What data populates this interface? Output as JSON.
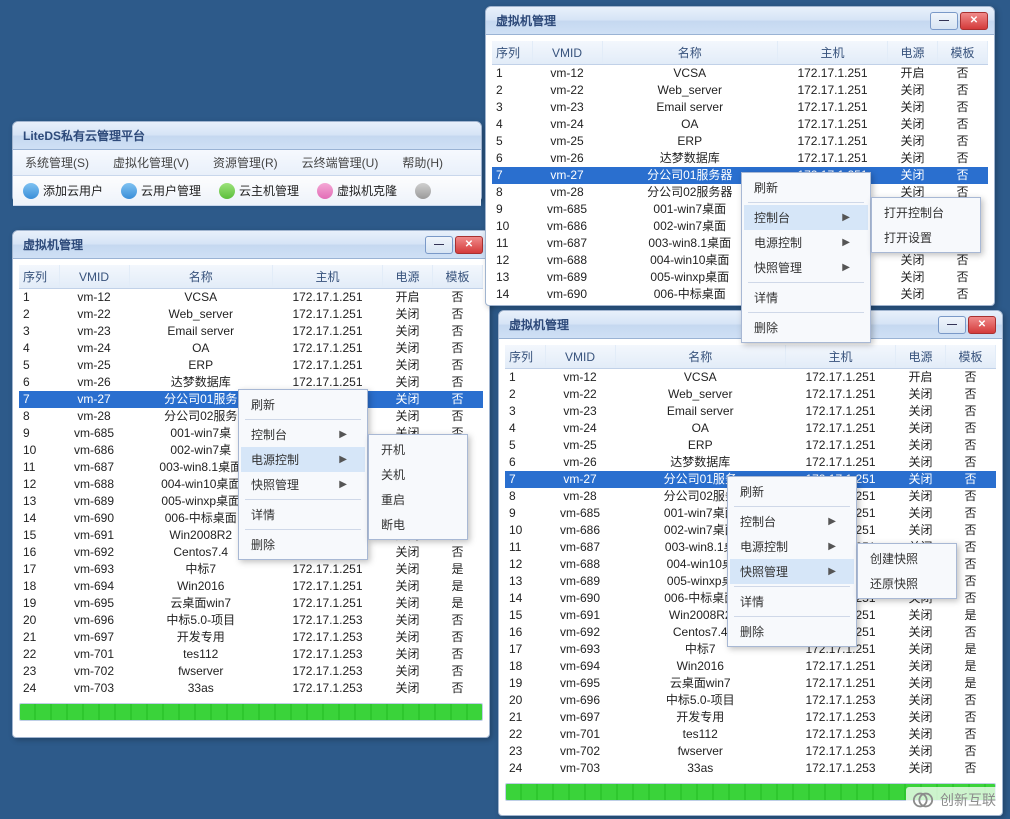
{
  "platform": {
    "title": "LiteDS私有云管理平台",
    "menubar": [
      {
        "label": "系统管理(S)"
      },
      {
        "label": "虚拟化管理(V)"
      },
      {
        "label": "资源管理(R)"
      },
      {
        "label": "云终端管理(U)"
      },
      {
        "label": "帮助(H)"
      }
    ],
    "toolbar": [
      {
        "id": "add-user",
        "label": "添加云用户",
        "icon": "user-plus-icon",
        "color": "blue"
      },
      {
        "id": "user-manage",
        "label": "云用户管理",
        "icon": "users-icon",
        "color": "blue"
      },
      {
        "id": "host-manage",
        "label": "云主机管理",
        "icon": "host-icon",
        "color": "green"
      },
      {
        "id": "vm-clone",
        "label": "虚拟机克隆",
        "icon": "clone-icon",
        "color": "pink"
      },
      {
        "id": "more",
        "label": "",
        "icon": "sync-icon",
        "color": "gray"
      }
    ]
  },
  "vm_window_title": "虚拟机管理",
  "columns": {
    "seq": "序列",
    "vmid": "VMID",
    "name": "名称",
    "host": "主机",
    "power": "电源",
    "template": "模板"
  },
  "rows_full": [
    {
      "seq": "1",
      "vmid": "vm-12",
      "name": "VCSA",
      "host": "172.17.1.251",
      "power": "开启",
      "template": "否"
    },
    {
      "seq": "2",
      "vmid": "vm-22",
      "name": "Web_server",
      "host": "172.17.1.251",
      "power": "关闭",
      "template": "否"
    },
    {
      "seq": "3",
      "vmid": "vm-23",
      "name": "Email server",
      "host": "172.17.1.251",
      "power": "关闭",
      "template": "否"
    },
    {
      "seq": "4",
      "vmid": "vm-24",
      "name": "OA",
      "host": "172.17.1.251",
      "power": "关闭",
      "template": "否"
    },
    {
      "seq": "5",
      "vmid": "vm-25",
      "name": "ERP",
      "host": "172.17.1.251",
      "power": "关闭",
      "template": "否"
    },
    {
      "seq": "6",
      "vmid": "vm-26",
      "name": "达梦数据库",
      "host": "172.17.1.251",
      "power": "关闭",
      "template": "否"
    },
    {
      "seq": "7",
      "vmid": "vm-27",
      "name": "分公司01服务器",
      "host": "172.17.1.251",
      "power": "关闭",
      "template": "否"
    },
    {
      "seq": "8",
      "vmid": "vm-28",
      "name": "分公司02服务器",
      "host": "172.17.1.251",
      "power": "关闭",
      "template": "否"
    },
    {
      "seq": "9",
      "vmid": "vm-685",
      "name": "001-win7桌面",
      "host": "172.17.1.251",
      "power": "关闭",
      "template": "否"
    },
    {
      "seq": "10",
      "vmid": "vm-686",
      "name": "002-win7桌面",
      "host": "172.17.1.251",
      "power": "关闭",
      "template": "否"
    },
    {
      "seq": "11",
      "vmid": "vm-687",
      "name": "003-win8.1桌面",
      "host": "172.17.1.251",
      "power": "关闭",
      "template": "否"
    },
    {
      "seq": "12",
      "vmid": "vm-688",
      "name": "004-win10桌面",
      "host": "172.17.1.251",
      "power": "关闭",
      "template": "否"
    },
    {
      "seq": "13",
      "vmid": "vm-689",
      "name": "005-winxp桌面",
      "host": "172.17.1.251",
      "power": "关闭",
      "template": "否"
    },
    {
      "seq": "14",
      "vmid": "vm-690",
      "name": "006-中标桌面",
      "host": "172.17.1.251",
      "power": "关闭",
      "template": "否"
    },
    {
      "seq": "15",
      "vmid": "vm-691",
      "name": "Win2008R2",
      "host": "172.17.1.251",
      "power": "关闭",
      "template": "是"
    },
    {
      "seq": "16",
      "vmid": "vm-692",
      "name": "Centos7.4",
      "host": "172.17.1.251",
      "power": "关闭",
      "template": "否"
    },
    {
      "seq": "17",
      "vmid": "vm-693",
      "name": "中标7",
      "host": "172.17.1.251",
      "power": "关闭",
      "template": "是"
    },
    {
      "seq": "18",
      "vmid": "vm-694",
      "name": "Win2016",
      "host": "172.17.1.251",
      "power": "关闭",
      "template": "是"
    },
    {
      "seq": "19",
      "vmid": "vm-695",
      "name": "云桌面win7",
      "host": "172.17.1.251",
      "power": "关闭",
      "template": "是"
    },
    {
      "seq": "20",
      "vmid": "vm-696",
      "name": "中标5.0-项目",
      "host": "172.17.1.253",
      "power": "关闭",
      "template": "否"
    },
    {
      "seq": "21",
      "vmid": "vm-697",
      "name": "开发专用",
      "host": "172.17.1.253",
      "power": "关闭",
      "template": "否"
    },
    {
      "seq": "22",
      "vmid": "vm-701",
      "name": "tes112",
      "host": "172.17.1.253",
      "power": "关闭",
      "template": "否"
    },
    {
      "seq": "23",
      "vmid": "vm-702",
      "name": "fwserver",
      "host": "172.17.1.253",
      "power": "关闭",
      "template": "否"
    },
    {
      "seq": "24",
      "vmid": "vm-703",
      "name": "33as",
      "host": "172.17.1.253",
      "power": "关闭",
      "template": "否"
    }
  ],
  "windowA": {
    "rows_count": 24,
    "selected_index": 6
  },
  "windowB": {
    "rows_count": 14,
    "selected_index": 6
  },
  "windowC": {
    "rows_count": 24,
    "selected_index": 6
  },
  "left_trunc_names": {
    "r7": "分公司01服务",
    "r8": "分公司02服务",
    "r9": "001-win7桌",
    "r10": "002-win7桌",
    "r11": "003-win8.1桌面",
    "r12": "004-win10桌面",
    "r13": "005-winxp桌面",
    "r14": "006-中标桌面"
  },
  "right_trunc_names": {
    "r7": "分公司01服务",
    "r8": "分公司02服务",
    "r9": "001-win7桌面",
    "r10": "002-win7桌面",
    "r11": "003-win8.1桌",
    "r12": "004-win10桌",
    "r13": "005-winxp桌",
    "r14": "006-中标桌面"
  },
  "ctx_main": {
    "refresh": "刷新",
    "console": "控制台",
    "power": "电源控制",
    "snapshot": "快照管理",
    "detail": "详情",
    "delete": "删除"
  },
  "ctx_power_sub": {
    "start": "开机",
    "stop": "关机",
    "restart": "重启",
    "cutoff": "断电"
  },
  "ctx_console_sub": {
    "open_console": "打开控制台",
    "open_settings": "打开设置"
  },
  "ctx_snapshot_sub": {
    "create": "创建快照",
    "restore": "还原快照"
  },
  "winbtn": {
    "min": "—",
    "max": "☐",
    "close": "✕"
  },
  "watermark": "创新互联"
}
